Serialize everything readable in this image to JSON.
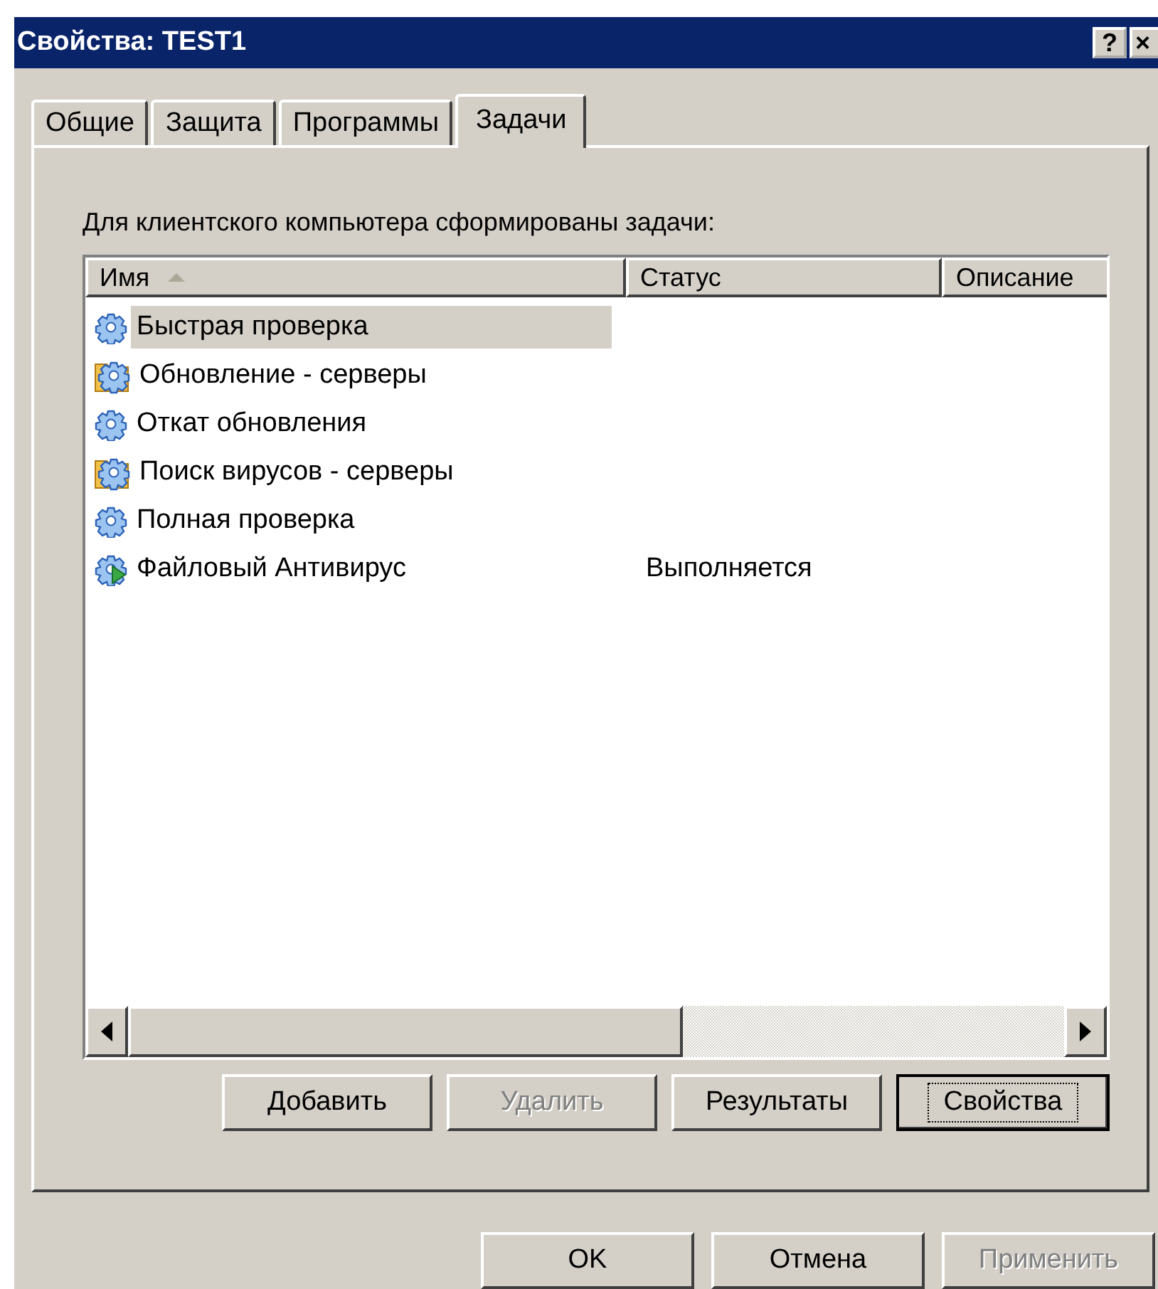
{
  "window": {
    "title": "Свойства: TEST1",
    "help_button": "?",
    "close_button": "×"
  },
  "tabs": [
    {
      "label": "Общие",
      "selected": false
    },
    {
      "label": "Защита",
      "selected": false
    },
    {
      "label": "Программы",
      "selected": false
    },
    {
      "label": "Задачи",
      "selected": true
    }
  ],
  "caption": "Для клиентского компьютера сформированы задачи:",
  "table": {
    "columns": [
      {
        "label": "Имя",
        "sorted": true
      },
      {
        "label": "Статус",
        "sorted": false
      },
      {
        "label": "Описание",
        "sorted": false
      }
    ],
    "rows": [
      {
        "kind": "task",
        "name": "Быстрая проверка",
        "selected": true
      },
      {
        "kind": "group",
        "name": "Обновление - серверы",
        "selected": false
      },
      {
        "kind": "task",
        "name": "Откат обновления",
        "selected": false
      },
      {
        "kind": "group",
        "name": "Поиск вирусов - серверы",
        "selected": false
      },
      {
        "kind": "task",
        "name": "Полная проверка",
        "selected": false
      },
      {
        "kind": "running",
        "name": "Файловый Антивирус",
        "status": "Выполняется",
        "selected": false
      }
    ]
  },
  "task_buttons": [
    {
      "label": "Добавить",
      "disabled": false,
      "focused": false
    },
    {
      "label": "Удалить",
      "disabled": true,
      "focused": false
    },
    {
      "label": "Результаты",
      "disabled": false,
      "focused": false
    },
    {
      "label": "Свойства",
      "disabled": false,
      "focused": true
    }
  ],
  "dialog_buttons": [
    {
      "label": "OK",
      "disabled": false,
      "focused": false
    },
    {
      "label": "Отмена",
      "disabled": false,
      "focused": false
    },
    {
      "label": "Применить",
      "disabled": true,
      "focused": false
    }
  ]
}
